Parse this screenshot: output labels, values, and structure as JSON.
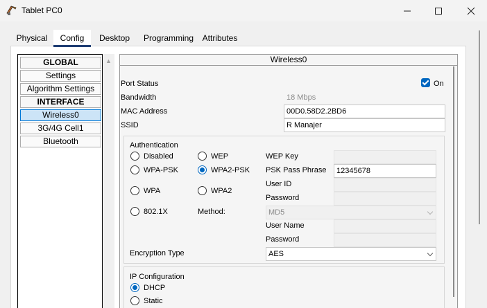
{
  "window": {
    "title": "Tablet PC0"
  },
  "tabs": [
    "Physical",
    "Config",
    "Desktop",
    "Programming",
    "Attributes"
  ],
  "left_list": {
    "global_header": "GLOBAL",
    "settings": "Settings",
    "algorithm_settings": "Algorithm Settings",
    "interface_header": "INTERFACE",
    "wireless0": "Wireless0",
    "cell": "3G/4G Cell1",
    "bluetooth": "Bluetooth"
  },
  "panel": {
    "title": "Wireless0",
    "port_status_label": "Port Status",
    "port_status_value": "On",
    "port_status_checked": true,
    "bandwidth_label": "Bandwidth",
    "bandwidth_value": "18 Mbps",
    "mac_label": "MAC Address",
    "mac_value": "00D0.58D2.2BD6",
    "ssid_label": "SSID",
    "ssid_value": "R Manajer"
  },
  "auth": {
    "title": "Authentication",
    "disabled": "Disabled",
    "wep": "WEP",
    "wpa_psk": "WPA-PSK",
    "wpa2_psk": "WPA2-PSK",
    "wpa": "WPA",
    "wpa2": "WPA2",
    "dot1x": "802.1X",
    "selected": "WPA2-PSK",
    "wep_key_label": "WEP Key",
    "psk_label": "PSK Pass Phrase",
    "psk_value": "12345678",
    "user_id_label": "User ID",
    "password_label": "Password",
    "method_label": "Method:",
    "method_value": "MD5",
    "user_name_label": "User Name",
    "password2_label": "Password",
    "encryption_label": "Encryption Type",
    "encryption_value": "AES"
  },
  "ip": {
    "title": "IP Configuration",
    "dhcp": "DHCP",
    "static": "Static",
    "selected": "DHCP"
  }
}
